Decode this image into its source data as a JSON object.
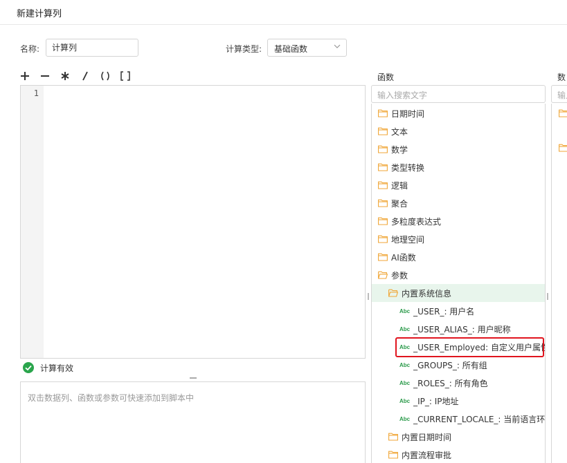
{
  "dialog": {
    "title": "新建计算列"
  },
  "form": {
    "name_label": "名称:",
    "name_value": "计算列",
    "type_label": "计算类型:",
    "type_value": "基础函数"
  },
  "toolbar": {
    "operators": [
      {
        "name": "plus",
        "label": "+"
      },
      {
        "name": "minus",
        "label": "−"
      },
      {
        "name": "multiply",
        "label": "*"
      },
      {
        "name": "divide",
        "label": "/"
      },
      {
        "name": "parentheses",
        "label": "()"
      },
      {
        "name": "brackets",
        "label": "[]"
      }
    ]
  },
  "editor": {
    "line_number": "1"
  },
  "validation": {
    "text": "计算有效",
    "color": "#2aa54c"
  },
  "hint": {
    "text": "双击数据列、函数或参数可快速添加到脚本中"
  },
  "functions_panel": {
    "title": "函数",
    "search_placeholder": "输入搜索文字",
    "categories": [
      "日期时间",
      "文本",
      "数学",
      "类型转换",
      "逻辑",
      "聚合",
      "多粒度表达式",
      "地理空间",
      "AI函数",
      "参数"
    ],
    "param_group": {
      "label": "内置系统信息"
    },
    "param_items": [
      "_USER_: 用户名",
      "_USER_ALIAS_: 用户昵称",
      "_USER_Employed: 自定义用户属性",
      "_GROUPS_: 所有组",
      "_ROLES_: 所有角色",
      "_IP_: IP地址",
      "_CURRENT_LOCALE_: 当前语言环境"
    ],
    "other_groups": [
      "内置日期时间",
      "内置流程审批"
    ],
    "abc_badge": "Abc"
  },
  "data_panel": {
    "title": "数",
    "search_placeholder": "输入"
  },
  "colors": {
    "folder": "#f0a637",
    "highlight": "#e0141e",
    "selected_bg": "#e8f5ec",
    "abc": "#2a9a4a"
  }
}
